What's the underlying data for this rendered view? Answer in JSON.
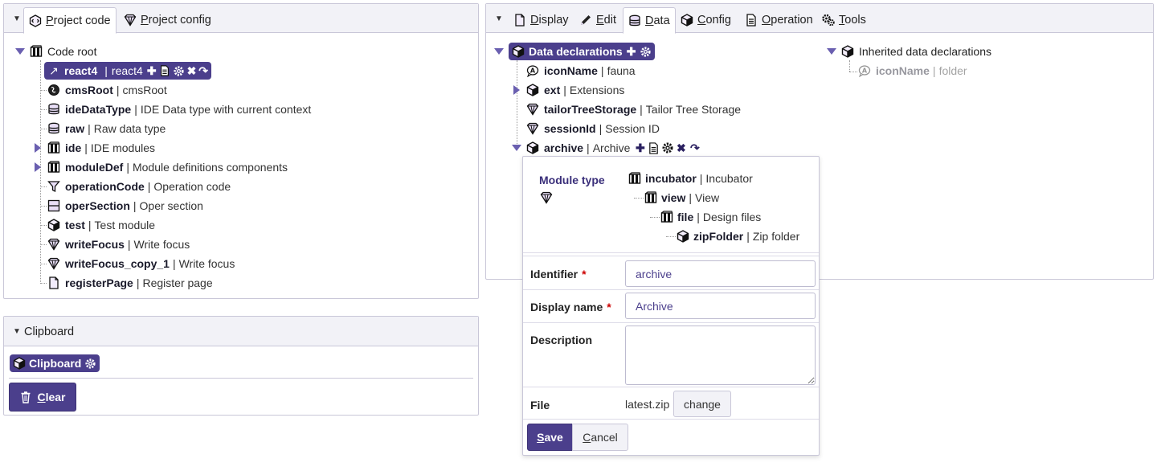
{
  "left_panel": {
    "tabs": [
      {
        "label": "Project code",
        "icon": "cube-code-icon",
        "active": true
      },
      {
        "label": "Project config",
        "icon": "config-diamond-icon",
        "active": false
      }
    ],
    "root_label": "Code root",
    "selected": {
      "name": "react4",
      "desc": "react4"
    },
    "items": [
      {
        "name": "cmsRoot",
        "desc": "cmsRoot",
        "icon": "cms-globe-icon"
      },
      {
        "name": "ideDataType",
        "desc": "IDE Data type with current context",
        "icon": "database-icon"
      },
      {
        "name": "raw",
        "desc": "Raw data type",
        "icon": "database-icon"
      },
      {
        "name": "ide",
        "desc": "IDE modules",
        "icon": "module-cube-icon",
        "expandable": true
      },
      {
        "name": "moduleDef",
        "desc": "Module definitions components",
        "icon": "module-cube-icon",
        "expandable": true
      },
      {
        "name": "operationCode",
        "desc": "Operation code",
        "icon": "funnel-icon"
      },
      {
        "name": "operSection",
        "desc": "Oper section",
        "icon": "section-icon"
      },
      {
        "name": "test",
        "desc": "Test module",
        "icon": "cube-icon"
      },
      {
        "name": "writeFocus",
        "desc": "Write focus",
        "icon": "diamond-icon"
      },
      {
        "name": "writeFocus_copy_1",
        "desc": "Write focus",
        "icon": "diamond-icon"
      },
      {
        "name": "registerPage",
        "desc": "Register page",
        "icon": "page-icon"
      }
    ]
  },
  "clipboard": {
    "title": "Clipboard",
    "pill_label": "Clipboard",
    "clear_label": "Clear"
  },
  "right_panel": {
    "tabs": [
      {
        "label": "Display",
        "icon": "page-icon"
      },
      {
        "label": "Edit",
        "icon": "pencil-icon"
      },
      {
        "label": "Data",
        "icon": "database-icon",
        "active": true
      },
      {
        "label": "Config",
        "icon": "cube-icon"
      },
      {
        "label": "Operation",
        "icon": "page-icon"
      },
      {
        "label": "Tools",
        "icon": "gears-icon"
      }
    ],
    "data_decl_label": "Data declarations",
    "items": [
      {
        "name": "iconName",
        "desc": "fauna"
      },
      {
        "name": "ext",
        "desc": "Extensions"
      },
      {
        "name": "tailorTreeStorage",
        "desc": "Tailor Tree Storage"
      },
      {
        "name": "sessionId",
        "desc": "Session ID"
      },
      {
        "name": "archive",
        "desc": "Archive"
      }
    ],
    "inherited_label": "Inherited data declarations",
    "inherited_item": {
      "name": "iconName",
      "desc": "folder"
    }
  },
  "popup": {
    "module_type_label": "Module type",
    "chain": [
      {
        "name": "incubator",
        "desc": "Incubator"
      },
      {
        "name": "view",
        "desc": "View"
      },
      {
        "name": "file",
        "desc": "Design files"
      },
      {
        "name": "zipFolder",
        "desc": "Zip folder"
      }
    ],
    "identifier_label": "Identifier",
    "identifier_value": "archive",
    "display_name_label": "Display name",
    "display_name_value": "Archive",
    "description_label": "Description",
    "description_value": "",
    "file_label": "File",
    "file_value": "latest.zip",
    "change_label": "change",
    "save_label": "Save",
    "cancel_label": "Cancel",
    "required_mark": "*"
  },
  "colors": {
    "accent": "#4b3f8c",
    "border": "#c9c7d8",
    "required": "#cc0000"
  }
}
